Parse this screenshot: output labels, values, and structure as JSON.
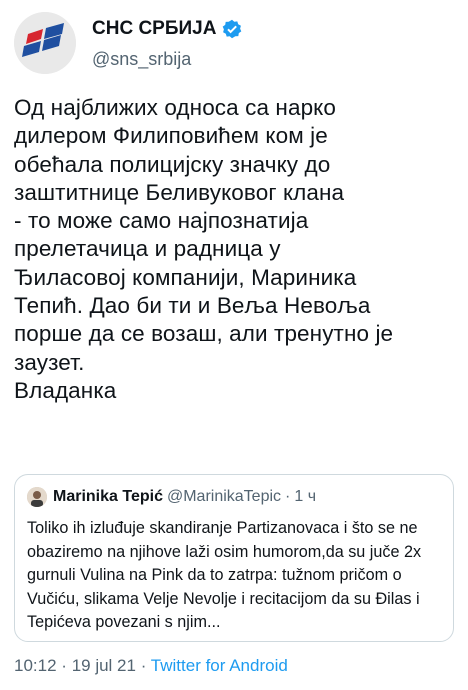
{
  "account": {
    "display_name": "СНС СРБИЈА",
    "handle": "@sns_srbija",
    "verified": true
  },
  "tweet": {
    "text": "Од најближих односа са нарко\nдилером Филиповићем ком је\nобећала полицијску значку до\nзаштитнице Беливуковог клана\n- то може само најпознатија\nпрелетачица и радница у\nЂиласовој компанији, Мариника\nТепић. Дао би ти и Веља Невоља\nпорше да се возаш, али тренутно је\nзаузет.\nВладанка"
  },
  "quoted_tweet": {
    "display_name": "Marinika Tepić",
    "handle": "@MarinikaTepic",
    "separator": "·",
    "time": "1 ч",
    "text": "Toliko ih izluđuje skandiranje Partizanovaca i što se ne obaziremo na njihove laži osim humorom,da su juče 2x gurnuli Vulina na Pink da to zatrpa: tužnom pričom o Vučiću, slikama Velje Nevolje i recitacijom da su Đilas i Tepićeva povezani s njim..."
  },
  "meta": {
    "time": "10:12",
    "separator1": "·",
    "date": "19 jul 21",
    "separator2": "·",
    "source": "Twitter for Android"
  },
  "colors": {
    "verified_badge": "#1d9bf0",
    "muted_text": "#536471",
    "link": "#1d9bf0",
    "logo_blue": "#1f4fa0",
    "logo_red": "#d7262f"
  }
}
